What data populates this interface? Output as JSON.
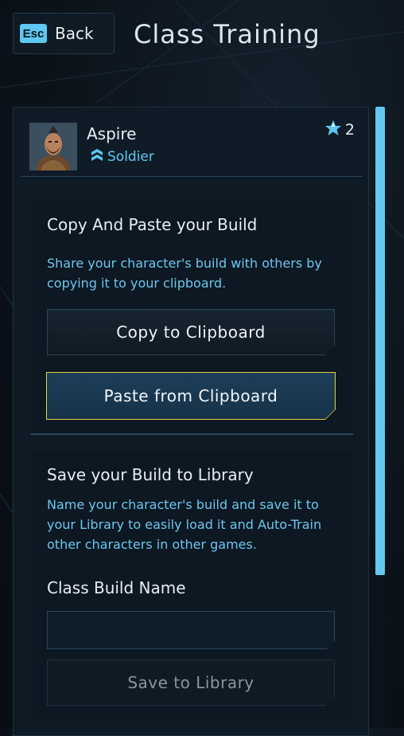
{
  "header": {
    "esc_key": "Esc",
    "back_label": "Back",
    "title": "Class Training"
  },
  "character": {
    "name": "Aspire",
    "class": "Soldier",
    "class_icon": "soldier-class-icon",
    "rank_icon": "star-rank-icon",
    "rank": "2"
  },
  "copy_section": {
    "title": "Copy And Paste your Build",
    "description": "Share your character's build with others by copying it to your clipboard.",
    "copy_button": "Copy to Clipboard",
    "paste_button": "Paste from Clipboard"
  },
  "save_section": {
    "title": "Save your Build to Library",
    "description": "Name your character's build and save it to your Library to easily load it and Auto-Train other characters in other games.",
    "input_label": "Class Build Name",
    "input_value": "",
    "save_button": "Save to Library"
  },
  "colors": {
    "accent": "#5ec8f0",
    "highlight_border": "#e2d23f",
    "panel_bg": "#0e1a24"
  }
}
